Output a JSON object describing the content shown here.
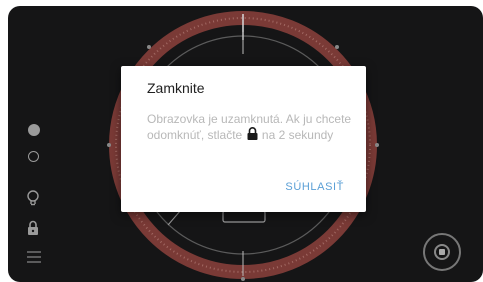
{
  "dialog": {
    "title": "Zamknite",
    "message_before": "Obrazovka je uzamknutá. Ak ju chcete odomknúť, stlačte",
    "message_after": "na 2 sekundy",
    "confirm_label": "SÚHLASIŤ"
  },
  "colors": {
    "background": "#151516",
    "dial_ring": "#7a3a36",
    "dialog_bg": "#ffffff",
    "accent": "#5a9fd6",
    "icon": "#9a9a9a"
  },
  "icons": [
    "dot-filled-icon",
    "dot-ring-icon",
    "bulb-icon",
    "lock-icon",
    "menu-icon",
    "stop-icon"
  ]
}
